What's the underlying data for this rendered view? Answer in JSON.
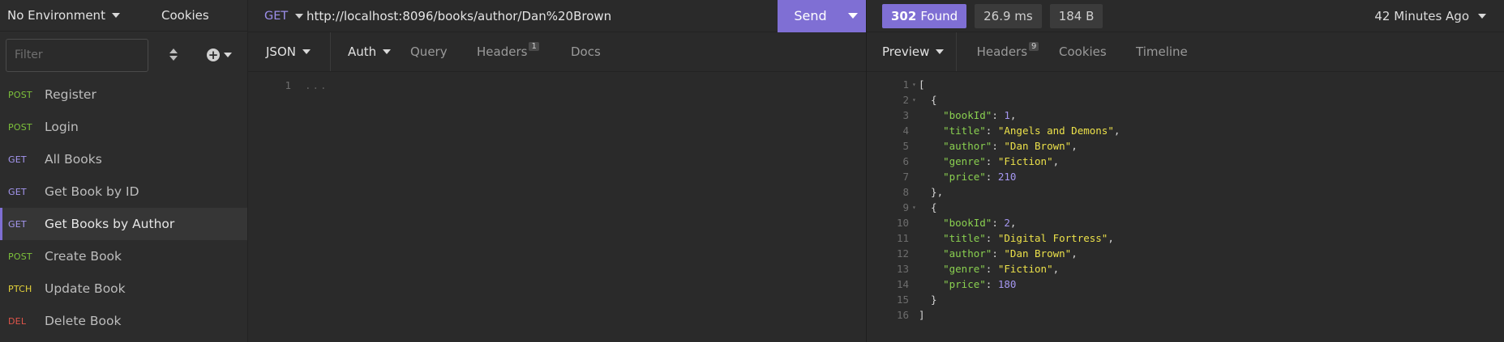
{
  "sidebar": {
    "environment": "No Environment",
    "cookies_label": "Cookies",
    "filter_placeholder": "Filter",
    "requests": [
      {
        "method": "POST",
        "name": "Register"
      },
      {
        "method": "POST",
        "name": "Login"
      },
      {
        "method": "GET",
        "name": "All Books"
      },
      {
        "method": "GET",
        "name": "Get Book by ID"
      },
      {
        "method": "GET",
        "name": "Get Books by Author",
        "active": true
      },
      {
        "method": "POST",
        "name": "Create Book"
      },
      {
        "method": "PTCH",
        "name": "Update Book"
      },
      {
        "method": "DEL",
        "name": "Delete Book"
      }
    ]
  },
  "request": {
    "method": "GET",
    "url": "http://localhost:8096/books/author/Dan%20Brown",
    "send_label": "Send",
    "tabs": {
      "json": "JSON",
      "auth": "Auth",
      "query": "Query",
      "headers": "Headers",
      "headers_count": "1",
      "docs": "Docs"
    },
    "body_line_number": "1",
    "body_placeholder": "..."
  },
  "response": {
    "status_code": "302",
    "status_text": "Found",
    "time": "26.9 ms",
    "size": "184 B",
    "time_ago": "42 Minutes Ago",
    "tabs": {
      "preview": "Preview",
      "headers": "Headers",
      "headers_count": "9",
      "cookies": "Cookies",
      "timeline": "Timeline"
    },
    "books": [
      {
        "bookId": 1,
        "title": "Angels and Demons",
        "author": "Dan Brown",
        "genre": "Fiction",
        "price": 210
      },
      {
        "bookId": 2,
        "title": "Digital Fortress",
        "author": "Dan Brown",
        "genre": "Fiction",
        "price": 180
      }
    ]
  },
  "colors": {
    "accent": "#7f6fd4",
    "post": "#7dc23b",
    "get": "#a597f0",
    "patch": "#e5d33a",
    "delete": "#e0554a",
    "json_key": "#8ad050",
    "json_string": "#ece14a",
    "json_number": "#a597f0"
  }
}
